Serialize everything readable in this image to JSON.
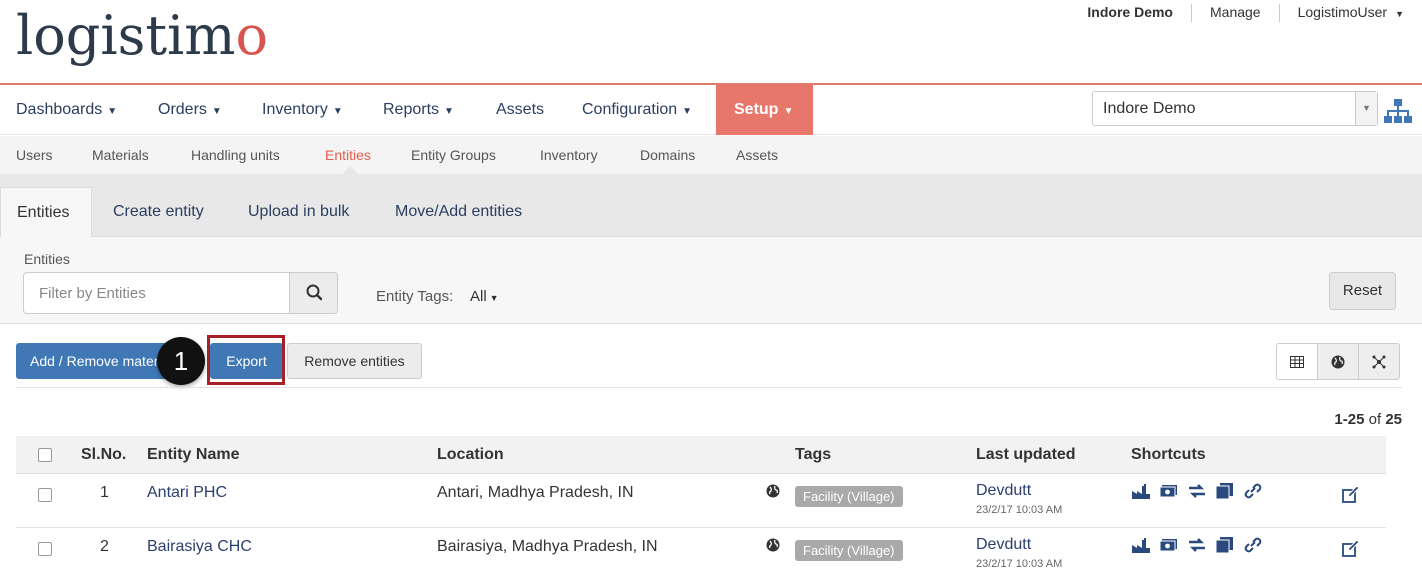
{
  "brand": {
    "logo_prefix": "logistim",
    "logo_suffix": "o"
  },
  "top_links": {
    "domain": "Indore Demo",
    "manage": "Manage",
    "user": "LogistimoUser"
  },
  "main_nav": {
    "items": [
      {
        "label": "Dashboards",
        "has_caret": true
      },
      {
        "label": "Orders",
        "has_caret": true
      },
      {
        "label": "Inventory",
        "has_caret": true
      },
      {
        "label": "Reports",
        "has_caret": true
      },
      {
        "label": "Assets",
        "has_caret": false
      },
      {
        "label": "Configuration",
        "has_caret": true
      },
      {
        "label": "Setup",
        "has_caret": true,
        "active": true
      }
    ],
    "domain_select": "Indore Demo",
    "active_color": "#e8776b"
  },
  "sub_nav": {
    "items": [
      "Users",
      "Materials",
      "Handling units",
      "Entities",
      "Entity Groups",
      "Inventory",
      "Domains",
      "Assets"
    ],
    "active": "Entities"
  },
  "tabs": [
    "Entities",
    "Create entity",
    "Upload in bulk",
    "Move/Add entities"
  ],
  "filter": {
    "label": "Entities",
    "placeholder": "Filter by Entities",
    "tags_label": "Entity Tags:",
    "tags_value": "All",
    "reset": "Reset"
  },
  "actions": {
    "add_remove": "Add / Remove materials",
    "export": "Export",
    "remove_entities": "Remove entities",
    "callout_number": "1",
    "highlight_color": "#a6202a",
    "primary_color": "#3f78b5"
  },
  "pager": {
    "range": "1-25",
    "of": "of",
    "total": "25"
  },
  "table": {
    "headers": {
      "slno": "Sl.No.",
      "name": "Entity Name",
      "location": "Location",
      "tags": "Tags",
      "updated": "Last updated",
      "shortcuts": "Shortcuts"
    },
    "rows": [
      {
        "slno": "1",
        "name": "Antari PHC",
        "location": "Antari, Madhya Pradesh, IN",
        "tag": "Facility (Village)",
        "updated_by": "Devdutt",
        "updated_at": "23/2/17 10:03 AM"
      },
      {
        "slno": "2",
        "name": "Bairasiya CHC",
        "location": "Bairasiya, Madhya Pradesh, IN",
        "tag": "Facility (Village)",
        "updated_by": "Devdutt",
        "updated_at": "23/2/17 10:03 AM"
      }
    ]
  }
}
